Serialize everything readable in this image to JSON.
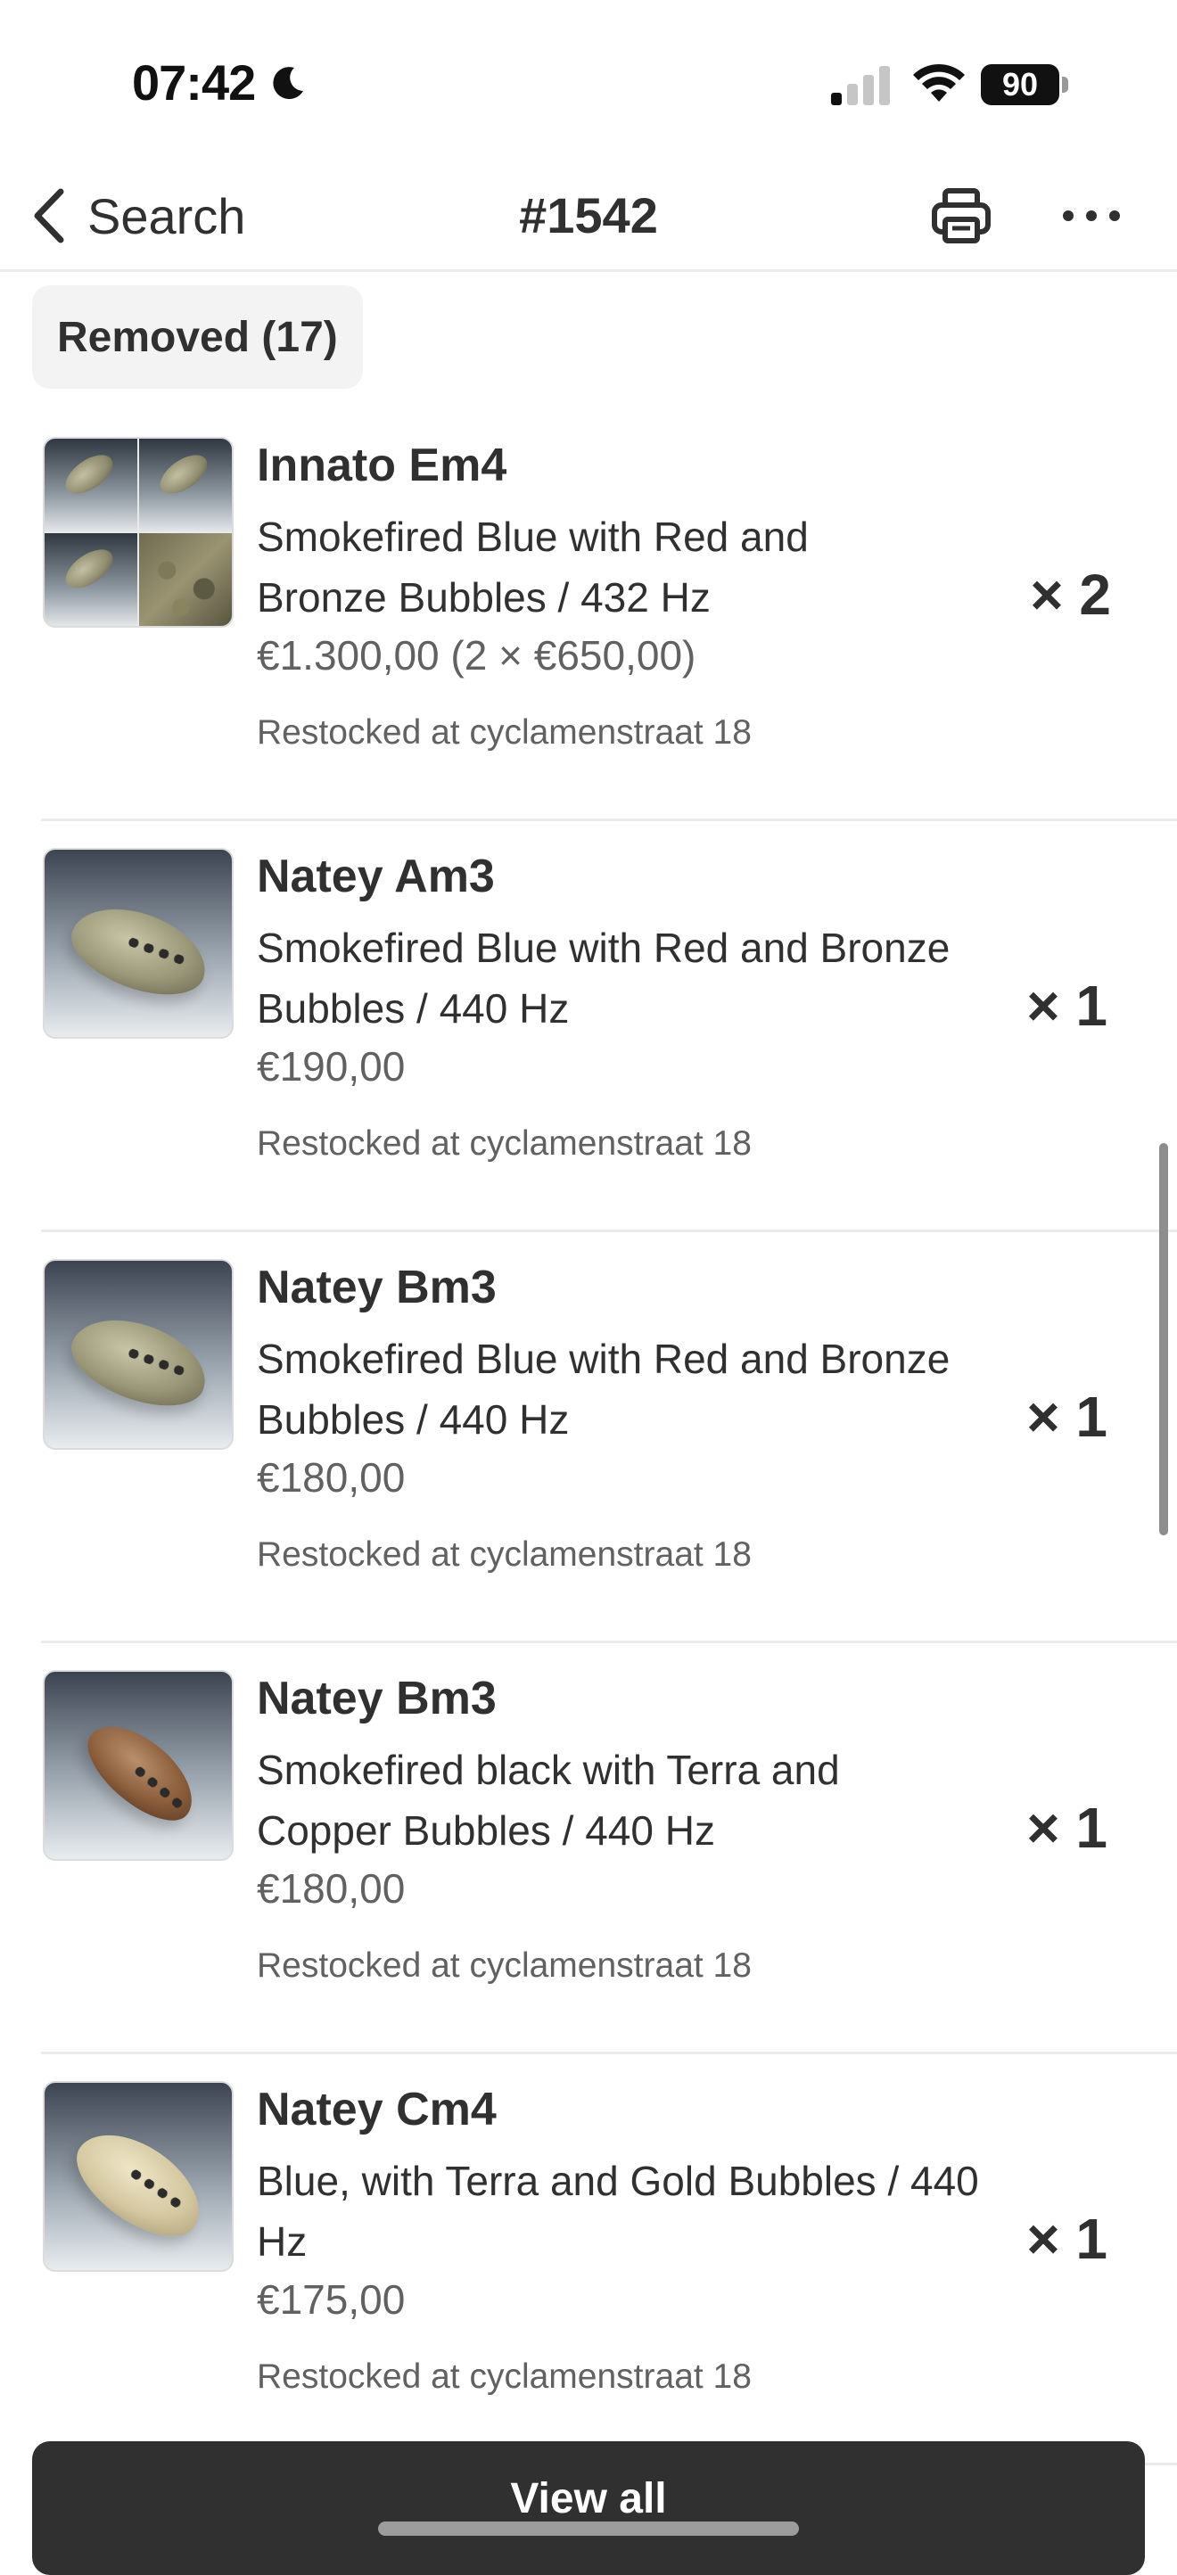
{
  "status_bar": {
    "time": "07:42",
    "battery": "90"
  },
  "nav": {
    "back_label": "Search",
    "title": "#1542"
  },
  "section": {
    "chip_label": "Removed (17)"
  },
  "items": [
    {
      "name": "Innato Em4",
      "description": "Smokefired Blue with Red and Bronze Bubbles / 432 Hz",
      "price": "€1.300,00 (2 × €650,00)",
      "location": "Restocked at cyclamenstraat 18",
      "quantity": "× 2"
    },
    {
      "name": "Natey Am3",
      "description": "Smokefired Blue with Red and Bronze Bubbles / 440 Hz",
      "price": "€190,00",
      "location": "Restocked at cyclamenstraat 18",
      "quantity": "× 1"
    },
    {
      "name": "Natey Bm3",
      "description": "Smokefired Blue with Red and Bronze Bubbles / 440 Hz",
      "price": "€180,00",
      "location": "Restocked at cyclamenstraat 18",
      "quantity": "× 1"
    },
    {
      "name": "Natey Bm3",
      "description": "Smokefired black with Terra and Copper Bubbles / 440 Hz",
      "price": "€180,00",
      "location": "Restocked at cyclamenstraat 18",
      "quantity": "× 1"
    },
    {
      "name": "Natey Cm4",
      "description": "Blue, with Terra and Gold Bubbles / 440 Hz",
      "price": "€175,00",
      "location": "Restocked at cyclamenstraat 18",
      "quantity": "× 1"
    }
  ],
  "footer": {
    "view_all_label": "View all"
  },
  "icons": {
    "back": "chevron-left-icon",
    "print": "printer-icon",
    "more": "ellipsis-icon",
    "moon": "moon-icon",
    "signal": "cellular-signal-icon",
    "wifi": "wifi-icon"
  }
}
